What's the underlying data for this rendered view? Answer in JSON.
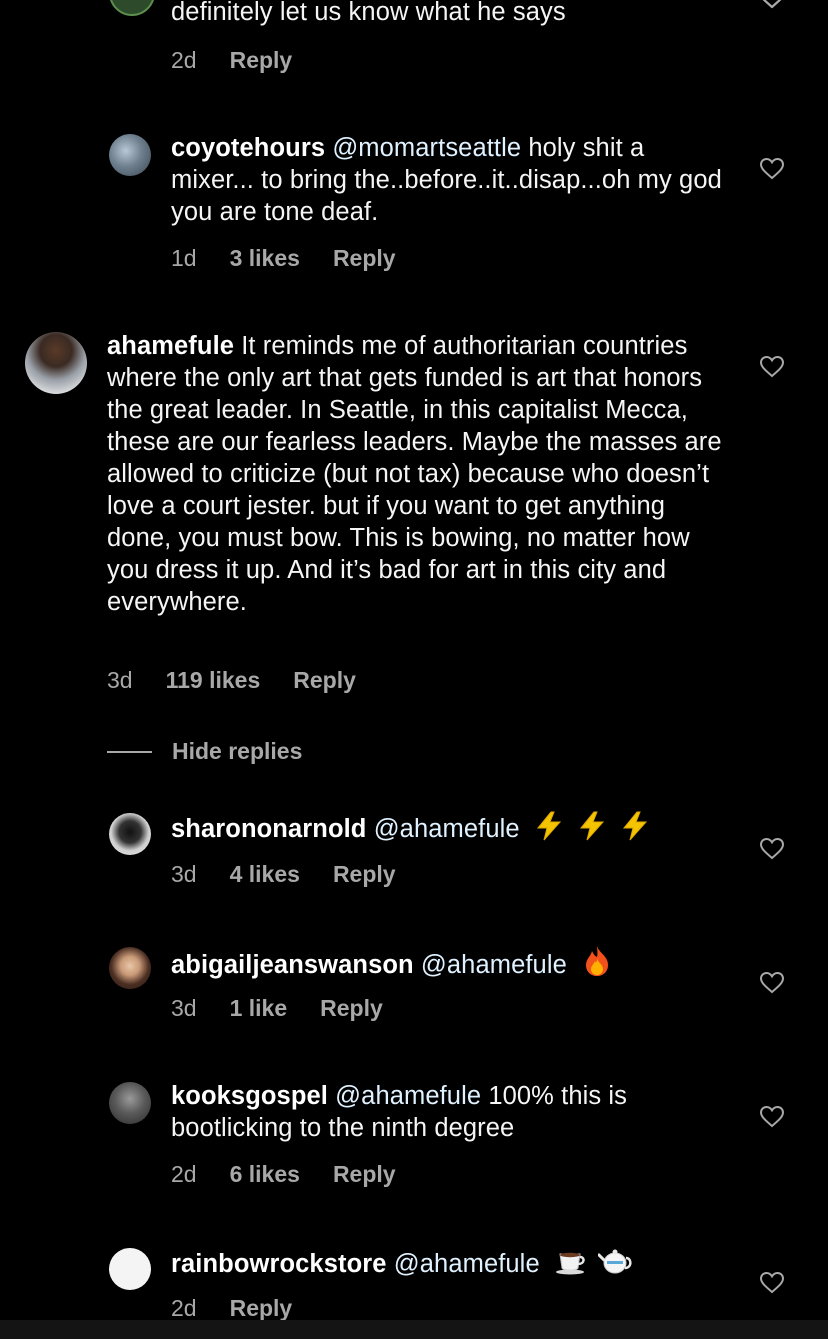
{
  "comments": [
    {
      "username": "",
      "mention": "",
      "text": "definitely let us know what he says",
      "time": "2d",
      "likes": "",
      "reply": "Reply"
    },
    {
      "username": "coyotehours",
      "mention": "@momartseattle",
      "text": " holy shit a mixer... to bring the..before..it..disap...oh my god you are tone deaf.",
      "time": "1d",
      "likes": "3 likes",
      "reply": "Reply"
    },
    {
      "username": "ahamefule",
      "mention": "",
      "text": " It reminds me of authoritarian countries where the only art that gets funded is art that honors the great leader. In Seattle, in this capitalist Mecca, these are our fearless leaders. Maybe the masses are allowed to criticize (but not tax) because who doesn’t love a court jester. but if you want to get anything done, you must bow. This is bowing, no matter how you dress it up. And it’s bad for art in this city and everywhere.",
      "time": "3d",
      "likes": "119 likes",
      "reply": "Reply"
    },
    {
      "username": "sharononarnold",
      "mention": "@ahamefule",
      "text": "",
      "time": "3d",
      "likes": "4 likes",
      "reply": "Reply"
    },
    {
      "username": "abigailjeanswanson",
      "mention": "@ahamefule",
      "text": "",
      "time": "3d",
      "likes": "1 like",
      "reply": "Reply"
    },
    {
      "username": "kooksgospel",
      "mention": "@ahamefule",
      "text": " 100% this is bootlicking to the ninth degree",
      "time": "2d",
      "likes": "6 likes",
      "reply": "Reply"
    },
    {
      "username": "rainbowrockstore",
      "mention": "@ahamefule",
      "text": "",
      "time": "2d",
      "likes": "",
      "reply": "Reply"
    }
  ],
  "hide_replies": "Hide replies",
  "icons": {
    "heart": "heart-outline-icon",
    "lightning": "high-voltage-emoji",
    "fire": "fire-emoji",
    "coffee": "hot-beverage-emoji",
    "teapot": "teapot-emoji"
  },
  "colors": {
    "background": "#000000",
    "text": "#f5f5f5",
    "secondary": "#a8a8a8",
    "mention": "#e0f1ff"
  }
}
